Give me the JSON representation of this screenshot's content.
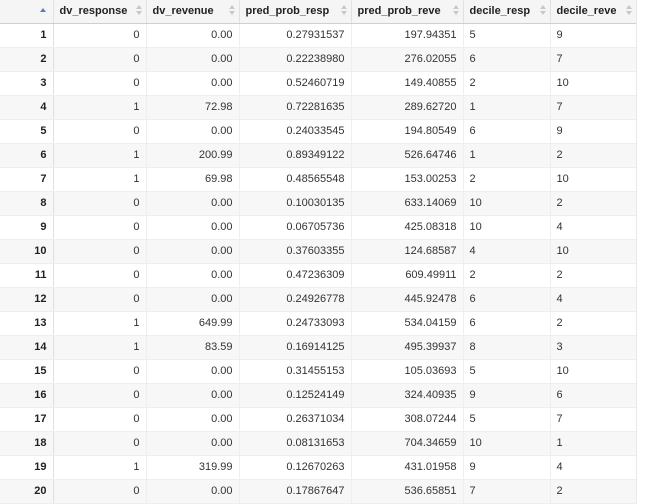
{
  "columns": [
    {
      "label": "dv_response",
      "align": "num"
    },
    {
      "label": "dv_revenue",
      "align": "num"
    },
    {
      "label": "pred_prob_resp",
      "align": "num"
    },
    {
      "label": "pred_prob_reve",
      "align": "num"
    },
    {
      "label": "decile_resp",
      "align": "chr"
    },
    {
      "label": "decile_reve",
      "align": "chr"
    }
  ],
  "rows": [
    {
      "n": "1",
      "c": [
        "0",
        "0.00",
        "0.27931537",
        "197.94351",
        "5",
        "9"
      ]
    },
    {
      "n": "2",
      "c": [
        "0",
        "0.00",
        "0.22238980",
        "276.02055",
        "6",
        "7"
      ]
    },
    {
      "n": "3",
      "c": [
        "0",
        "0.00",
        "0.52460719",
        "149.40855",
        "2",
        "10"
      ]
    },
    {
      "n": "4",
      "c": [
        "1",
        "72.98",
        "0.72281635",
        "289.62720",
        "1",
        "7"
      ]
    },
    {
      "n": "5",
      "c": [
        "0",
        "0.00",
        "0.24033545",
        "194.80549",
        "6",
        "9"
      ]
    },
    {
      "n": "6",
      "c": [
        "1",
        "200.99",
        "0.89349122",
        "526.64746",
        "1",
        "2"
      ]
    },
    {
      "n": "7",
      "c": [
        "1",
        "69.98",
        "0.48565548",
        "153.00253",
        "2",
        "10"
      ]
    },
    {
      "n": "8",
      "c": [
        "0",
        "0.00",
        "0.10030135",
        "633.14069",
        "10",
        "2"
      ]
    },
    {
      "n": "9",
      "c": [
        "0",
        "0.00",
        "0.06705736",
        "425.08318",
        "10",
        "4"
      ]
    },
    {
      "n": "10",
      "c": [
        "0",
        "0.00",
        "0.37603355",
        "124.68587",
        "4",
        "10"
      ]
    },
    {
      "n": "11",
      "c": [
        "0",
        "0.00",
        "0.47236309",
        "609.49911",
        "2",
        "2"
      ]
    },
    {
      "n": "12",
      "c": [
        "0",
        "0.00",
        "0.24926778",
        "445.92478",
        "6",
        "4"
      ]
    },
    {
      "n": "13",
      "c": [
        "1",
        "649.99",
        "0.24733093",
        "534.04159",
        "6",
        "2"
      ]
    },
    {
      "n": "14",
      "c": [
        "1",
        "83.59",
        "0.16914125",
        "495.39937",
        "8",
        "3"
      ]
    },
    {
      "n": "15",
      "c": [
        "0",
        "0.00",
        "0.31455153",
        "105.03693",
        "5",
        "10"
      ]
    },
    {
      "n": "16",
      "c": [
        "0",
        "0.00",
        "0.12524149",
        "324.40935",
        "9",
        "6"
      ]
    },
    {
      "n": "17",
      "c": [
        "0",
        "0.00",
        "0.26371034",
        "308.07244",
        "5",
        "7"
      ]
    },
    {
      "n": "18",
      "c": [
        "0",
        "0.00",
        "0.08131653",
        "704.34659",
        "10",
        "1"
      ]
    },
    {
      "n": "19",
      "c": [
        "1",
        "319.99",
        "0.12670263",
        "431.01958",
        "9",
        "4"
      ]
    },
    {
      "n": "20",
      "c": [
        "0",
        "0.00",
        "0.17867647",
        "536.65851",
        "7",
        "2"
      ]
    }
  ]
}
